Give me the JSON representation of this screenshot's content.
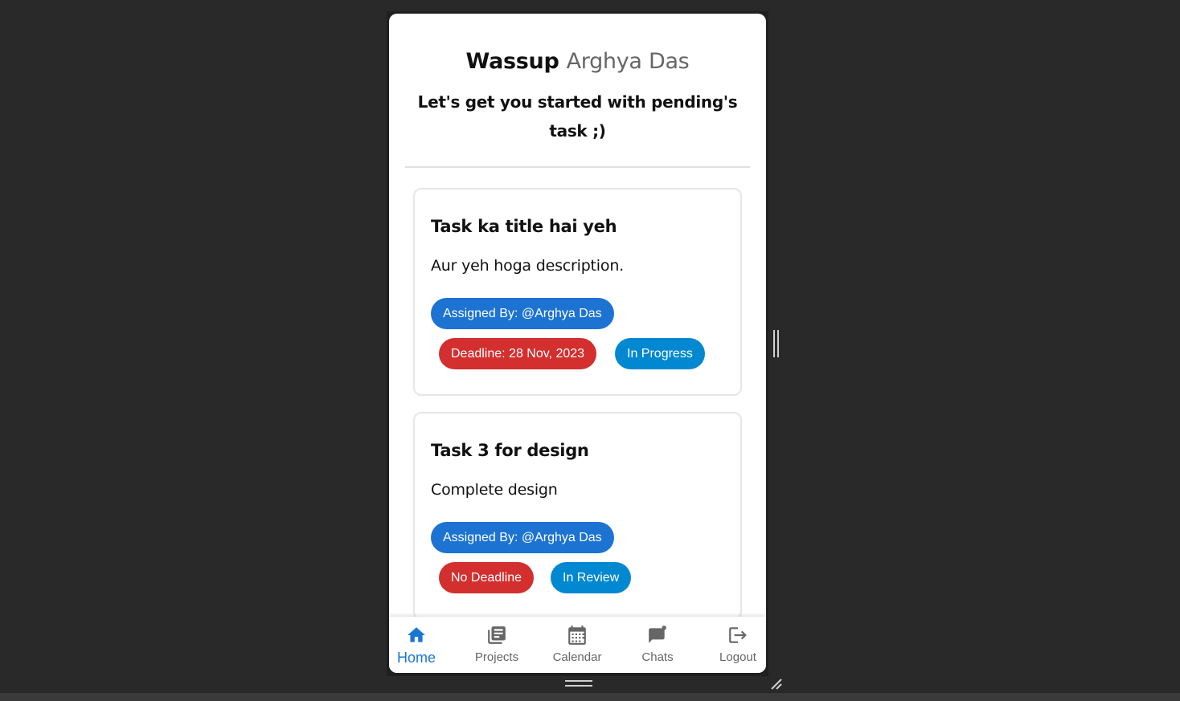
{
  "header": {
    "greeting_prefix": "Wassup",
    "user_name": "Arghya Das",
    "subtitle": "Let's get you started with pending's task ;)"
  },
  "tasks": [
    {
      "title": "Task ka title hai yeh",
      "description": "Aur yeh hoga description.",
      "assigned_by": "Assigned By: @Arghya Das",
      "deadline": "Deadline: 28 Nov, 2023",
      "status": "In Progress"
    },
    {
      "title": "Task 3 for design",
      "description": "Complete design",
      "assigned_by": "Assigned By: @Arghya Das",
      "deadline": "No Deadline",
      "status": "In Review"
    }
  ],
  "nav": {
    "items": [
      {
        "label": "Home",
        "icon": "home-icon",
        "active": true
      },
      {
        "label": "Projects",
        "icon": "library-books-icon",
        "active": false
      },
      {
        "label": "Calendar",
        "icon": "calendar-icon",
        "active": false
      },
      {
        "label": "Chats",
        "icon": "chat-badge-icon",
        "active": false
      },
      {
        "label": "Logout",
        "icon": "logout-icon",
        "active": false
      }
    ]
  },
  "colors": {
    "background": "#292929",
    "primary": "#1976d2",
    "assigned_chip": "#1c73d2",
    "deadline_chip": "#d32f2f",
    "status_chip": "#0288d1",
    "muted_name": "#666666"
  }
}
